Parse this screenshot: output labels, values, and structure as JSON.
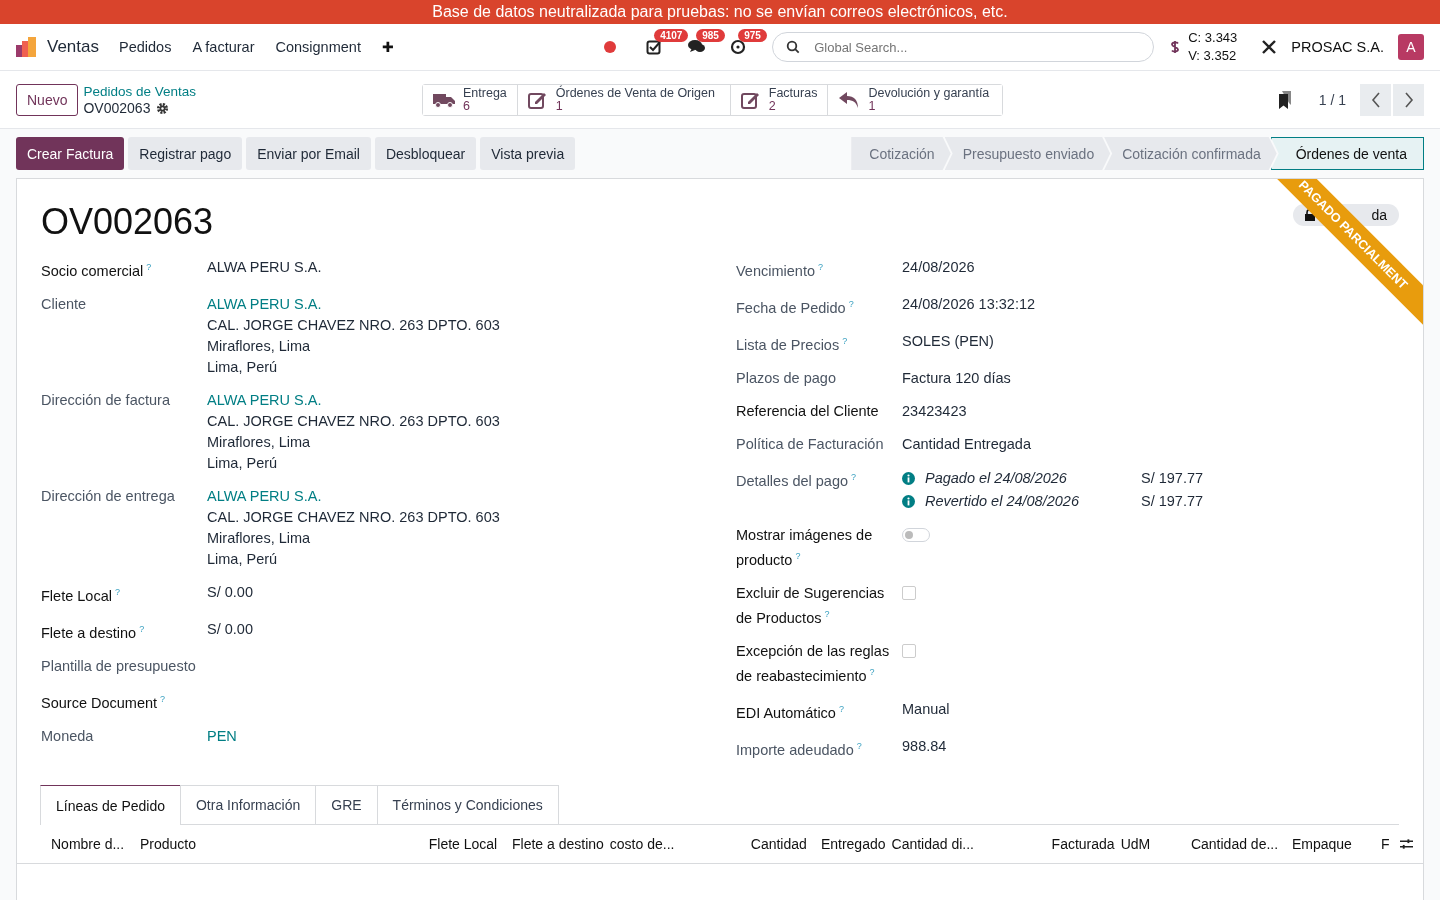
{
  "banner": "Base de datos neutralizada para pruebas: no se envían correos electrónicos, etc.",
  "navbar": {
    "app": "Ventas",
    "menus": [
      "Pedidos",
      "A facturar",
      "Consignment"
    ],
    "plus": "✚",
    "systray": [
      {
        "kind": "record"
      },
      {
        "kind": "activity",
        "badge": "4107"
      },
      {
        "kind": "chat",
        "badge": "985"
      },
      {
        "kind": "clock",
        "badge": "975"
      }
    ],
    "search": {
      "placeholder": "Global Search..."
    },
    "rates": [
      "C: 3.343",
      "V: 3.352"
    ],
    "company": "PROSAC S.A.",
    "avatar": "A"
  },
  "breadcrumb": {
    "new_button": "Nuevo",
    "parent": "Pedidos de Ventas",
    "record": "OV002063"
  },
  "stat_buttons": [
    {
      "kind": "truck",
      "label": "Entrega",
      "count": "6"
    },
    {
      "kind": "edit",
      "label": "Órdenes de Venta de Origen",
      "count": "1"
    },
    {
      "kind": "edit",
      "label": "Facturas",
      "count": "2"
    },
    {
      "kind": "reply",
      "label": "Devolución y garantía",
      "count": "1"
    }
  ],
  "pager": "1 / 1",
  "actions": [
    {
      "label": "Crear Factura",
      "primary": true
    },
    {
      "label": "Registrar pago",
      "primary": false
    },
    {
      "label": "Enviar por Email",
      "primary": false
    },
    {
      "label": "Desbloquear",
      "primary": false
    },
    {
      "label": "Vista previa",
      "primary": false
    }
  ],
  "stages": [
    {
      "label": "Cotización",
      "selected": false
    },
    {
      "label": "Presupuesto enviado",
      "selected": false
    },
    {
      "label": "Cotización confirmada",
      "selected": false
    },
    {
      "label": "Órdenes de venta",
      "selected": true
    }
  ],
  "ribbon": "PAGADO PARCIALMENT",
  "lock_badge": "da",
  "title": "OV002063",
  "left_fields": [
    {
      "label": "Socio comercial",
      "strong": true,
      "help": true,
      "lines": [
        "ALWA PERU S.A."
      ]
    },
    {
      "label": "Cliente",
      "strong": false,
      "help": false,
      "lines": [
        "ALWA PERU S.A.",
        "CAL. JORGE CHAVEZ NRO. 263 DPTO. 603",
        "Miraflores, Lima",
        "Lima, Perú"
      ],
      "link": true
    },
    {
      "label": "Dirección de factura",
      "strong": false,
      "help": false,
      "lines": [
        "ALWA PERU S.A.",
        "CAL. JORGE CHAVEZ NRO. 263 DPTO. 603",
        "Miraflores, Lima",
        "Lima, Perú"
      ],
      "link": true
    },
    {
      "label": "Dirección de entrega",
      "strong": false,
      "help": false,
      "lines": [
        "ALWA PERU S.A.",
        "CAL. JORGE CHAVEZ NRO. 263 DPTO. 603",
        "Miraflores, Lima",
        "Lima, Perú"
      ],
      "link": true
    },
    {
      "label": "Flete Local",
      "strong": true,
      "help": true,
      "lines": [
        "S/ 0.00"
      ]
    },
    {
      "label": "Flete a destino",
      "strong": true,
      "help": true,
      "lines": [
        "S/ 0.00"
      ]
    },
    {
      "label": "Plantilla de presupuesto",
      "strong": false,
      "help": false
    },
    {
      "label": "Source Document",
      "strong": true,
      "help": true
    },
    {
      "label": "Moneda",
      "strong": false,
      "help": false,
      "lines": [
        "PEN"
      ],
      "link": true
    }
  ],
  "right_fields": [
    {
      "kind": "text",
      "label": "Vencimiento",
      "strong": false,
      "help": true,
      "value": "24/08/2026"
    },
    {
      "kind": "text",
      "label": "Fecha de Pedido",
      "strong": false,
      "help": true,
      "value": "24/08/2026 13:32:12"
    },
    {
      "kind": "text",
      "label": "Lista de Precios",
      "strong": false,
      "help": true,
      "value": "SOLES (PEN)"
    },
    {
      "kind": "text",
      "label": "Plazos de pago",
      "strong": false,
      "help": false,
      "value": "Factura 120 días"
    },
    {
      "kind": "text",
      "label": "Referencia del Cliente",
      "strong": true,
      "help": false,
      "value": "23423423"
    },
    {
      "kind": "text",
      "label": "Política de Facturación",
      "strong": false,
      "help": false,
      "value": "Cantidad Entregada"
    },
    {
      "kind": "payments",
      "label": "Detalles del pago",
      "strong": false,
      "help": true,
      "payments": [
        {
          "text": "Pagado el 24/08/2026",
          "amount": "S/ 197.77"
        },
        {
          "text": "Revertido el 24/08/2026",
          "amount": "S/ 197.77"
        }
      ]
    },
    {
      "kind": "toggle",
      "label": "Mostrar imágenes de producto",
      "strong": true,
      "help": true,
      "on": false
    },
    {
      "kind": "checkbox",
      "label": "Excluir de Sugerencias de Productos",
      "strong": true,
      "help": true,
      "checked": false
    },
    {
      "kind": "checkbox",
      "label": "Excepción de las reglas de reabastecimiento",
      "strong": true,
      "help": true,
      "checked": false
    },
    {
      "kind": "text",
      "label": "EDI Automático",
      "strong": true,
      "help": true,
      "value": "Manual"
    },
    {
      "kind": "text",
      "label": "Importe adeudado",
      "strong": false,
      "help": true,
      "value": "988.84"
    }
  ],
  "help_mark": "?",
  "tabs": [
    {
      "label": "Líneas de Pedido",
      "selected": true
    },
    {
      "label": "Otra Información",
      "selected": false
    },
    {
      "label": "GRE",
      "selected": false
    },
    {
      "label": "Términos y Condiciones",
      "selected": false
    }
  ],
  "columns": [
    "Nombre d...",
    "Producto",
    "Flete Local",
    "Flete a destino",
    "costo de...",
    "Cantidad",
    "Entregado",
    "Cantidad di...",
    "Facturada",
    "UdM",
    "Cantidad de...",
    "Empaque",
    "F"
  ]
}
